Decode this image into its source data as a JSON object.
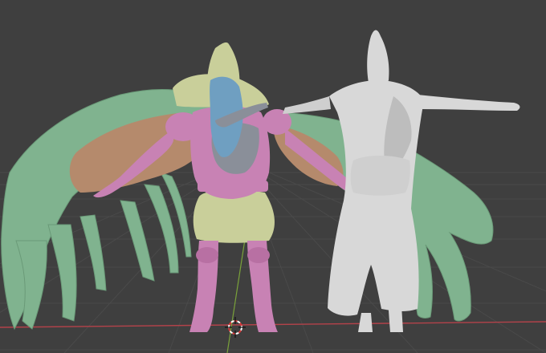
{
  "viewport": {
    "background": "#3f3f3f",
    "grid_color": "#4a4a4a",
    "x_axis_color": "#b3424a",
    "y_axis_color": "#7aa23a"
  },
  "objects": {
    "left_figure": {
      "name": "armored-knight-mesh",
      "colors": {
        "armor": "#c882b4",
        "cloth": "#c9cf9a",
        "cape": "#b58a6c",
        "feathers": "#80b38f",
        "hair": "#6f9fc1",
        "face_gray": "#8a8f99"
      }
    },
    "right_figure": {
      "name": "cloaked-figure-mesh",
      "colors": {
        "body": "#d8d8d8",
        "shadow": "#bdbdbd"
      }
    }
  },
  "cursor": {
    "name": "3d-cursor",
    "color_a": "#ffffff",
    "color_b": "#d83a3a"
  }
}
